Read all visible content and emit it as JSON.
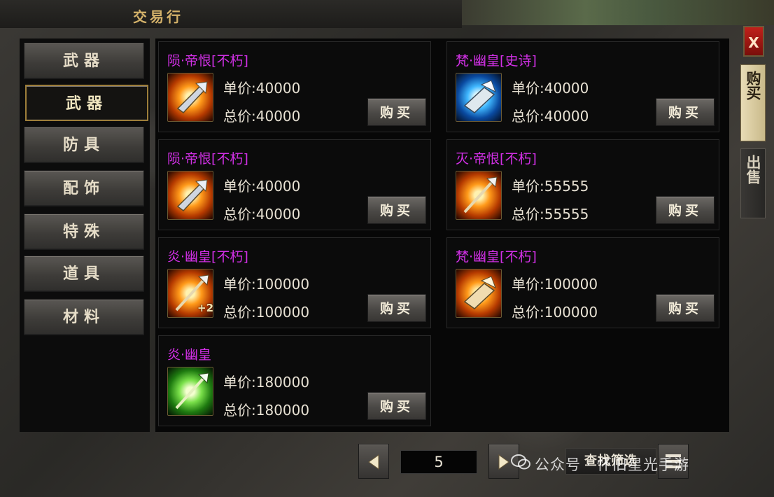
{
  "window": {
    "title": "交易行",
    "close_label": "X"
  },
  "side_tabs": {
    "buy": "购买",
    "sell": "出售"
  },
  "categories": [
    {
      "label": "武器",
      "active": false
    },
    {
      "label": "武器",
      "active": true
    },
    {
      "label": "防具",
      "active": false
    },
    {
      "label": "配饰",
      "active": false
    },
    {
      "label": "特殊",
      "active": false
    },
    {
      "label": "道具",
      "active": false
    },
    {
      "label": "材料",
      "active": false
    }
  ],
  "price_labels": {
    "unit": "单价:",
    "total": "总价:"
  },
  "buy_label": "购买",
  "listings": [
    {
      "name": "陨·帝恨[不朽]",
      "unit_price": "40000",
      "total_price": "40000",
      "icon": "weapon-orange-icon",
      "glow": "#ff9a1a"
    },
    {
      "name": "梵·幽皇[史诗]",
      "unit_price": "40000",
      "total_price": "40000",
      "icon": "weapon-blue-icon",
      "glow": "#40b8ff"
    },
    {
      "name": "陨·帝恨[不朽]",
      "unit_price": "40000",
      "total_price": "40000",
      "icon": "weapon-orange-icon",
      "glow": "#ff9a1a"
    },
    {
      "name": "灭·帝恨[不朽]",
      "unit_price": "55555",
      "total_price": "55555",
      "icon": "halberd-orange-icon",
      "glow": "#ff9a1a"
    },
    {
      "name": "炎·幽皇[不朽]",
      "unit_price": "100000",
      "total_price": "100000",
      "icon": "halberd-orange-icon",
      "glow": "#ff9a1a",
      "enhance": "+2"
    },
    {
      "name": "梵·幽皇[不朽]",
      "unit_price": "100000",
      "total_price": "100000",
      "icon": "weapon-orange-icon",
      "glow": "#ff9a1a"
    },
    {
      "name": "炎·幽皇",
      "unit_price": "180000",
      "total_price": "180000",
      "icon": "halberd-green-icon",
      "glow": "#7ae04a"
    }
  ],
  "pagination": {
    "page": "5"
  },
  "search": {
    "label": "查找筛选"
  },
  "watermark": {
    "text": "公众号 · 怀旧星光手游"
  },
  "colors": {
    "item_name": "#d230e6",
    "accent_gold": "#9d7e3a",
    "close_red": "#c0201a"
  }
}
